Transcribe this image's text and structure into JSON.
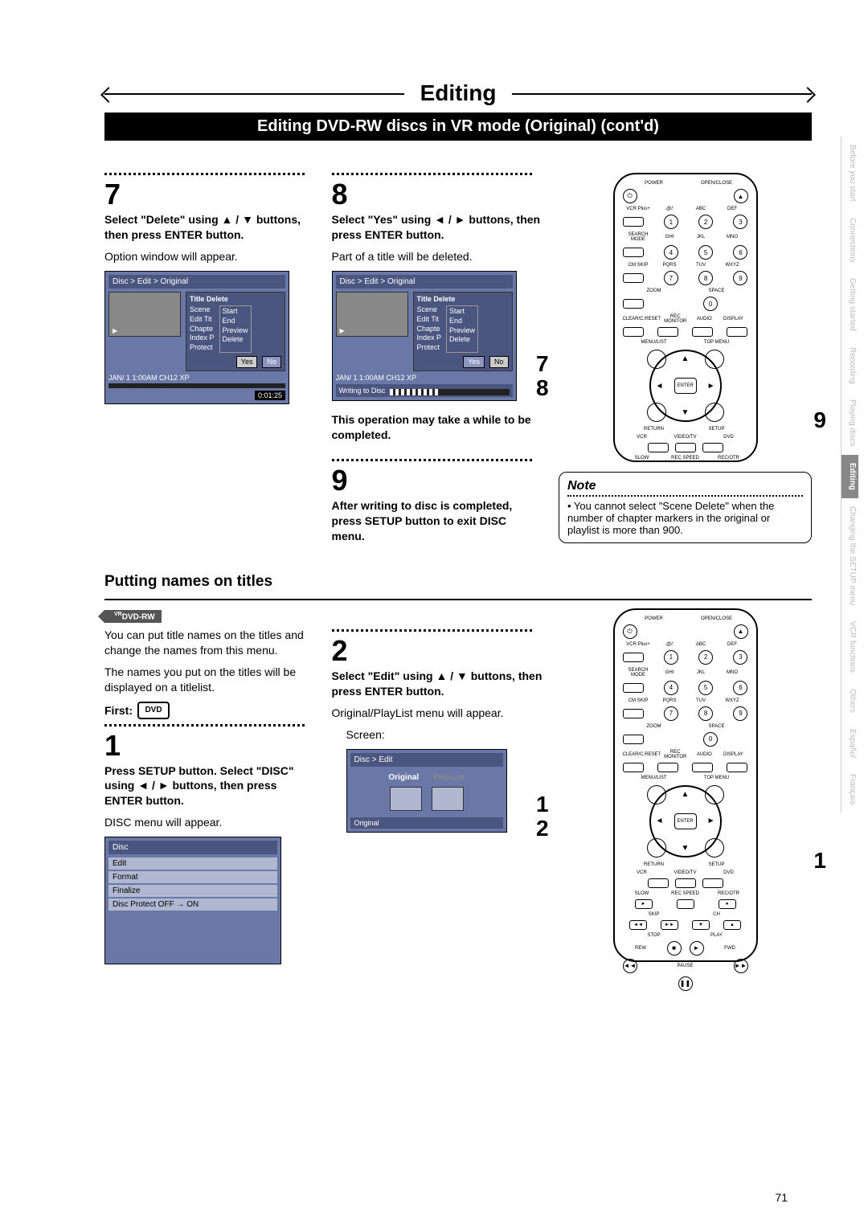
{
  "page_title": "Editing",
  "subtitle": "Editing DVD-RW discs in VR mode (Original) (cont'd)",
  "page_number": "71",
  "side_tabs": [
    "Before you start",
    "Connections",
    "Getting started",
    "Recording",
    "Playing discs",
    "Editing",
    "Changing the SETUP menu",
    "VCR functions",
    "Others",
    "Español",
    "Français"
  ],
  "active_side_tab": "Editing",
  "step7": {
    "num": "7",
    "instruction": "Select \"Delete\" using ▲ / ▼ buttons, then press ENTER button.",
    "body": "Option window will appear.",
    "screen": {
      "breadcrumb": "Disc > Edit > Original",
      "panel_title": "Title Delete",
      "rows": [
        "Scene",
        "Edit Tit",
        "Chapte",
        "Index P",
        "Protect"
      ],
      "rows_r": [
        "Start",
        "End",
        "Preview",
        "Delete"
      ],
      "yes": "Yes",
      "no": "No",
      "status": "JAN/ 1  1:00AM  CH12    XP",
      "timecode": "0:01:25"
    }
  },
  "step8": {
    "num": "8",
    "instruction": "Select \"Yes\" using ◄ / ► buttons, then press ENTER button.",
    "body": "Part of a title will be deleted.",
    "note": "This operation may take a while to be completed.",
    "screen": {
      "breadcrumb": "Disc > Edit > Original",
      "panel_title": "Title Delete",
      "rows": [
        "Scene",
        "Edit Tit",
        "Chapte",
        "Index P",
        "Protect"
      ],
      "rows_r": [
        "Start",
        "End",
        "Preview",
        "Delete"
      ],
      "yes": "Yes",
      "no": "No",
      "status": "JAN/ 1  1:00AM  CH12    XP",
      "writing": "Writing to Disc"
    }
  },
  "step9": {
    "num": "9",
    "instruction": "After writing to disc is completed, press SETUP button to exit DISC menu."
  },
  "note_box": {
    "title": "Note",
    "body": "• You cannot select \"Scene Delete\" when the number of chapter markers in the original or playlist is more than 900."
  },
  "section2": {
    "heading": "Putting names on titles",
    "badge": "DVD-RW",
    "badge_sup": "VR",
    "intro1": "You can put title names on the titles and change the names from this menu.",
    "intro2": "The names you put on the titles will be displayed on a titlelist.",
    "first_label": "First:",
    "step1": {
      "num": "1",
      "instruction": "Press SETUP button. Select \"DISC\" using ◄ / ► buttons, then press ENTER button.",
      "body": "DISC menu will appear.",
      "menu": {
        "header": "Disc",
        "items": [
          "Edit",
          "Format",
          "Finalize",
          "Disc Protect OFF → ON"
        ]
      }
    },
    "step2": {
      "num": "2",
      "instruction": "Select \"Edit\" using ▲ / ▼ buttons, then press ENTER button.",
      "body": "Original/PlayList menu will appear.",
      "body2": "Screen:",
      "menu": {
        "header": "Disc > Edit",
        "tab_original": "Original",
        "tab_playlist": "PlayList",
        "footer": "Original"
      }
    }
  },
  "remote_labels": {
    "power": "POWER",
    "open": "OPEN/CLOSE",
    "enter": "ENTER",
    "setup": "SETUP",
    "return": "RETURN",
    "menu": "MENU/LIST",
    "topmenu": "TOP MENU",
    "zoom": "ZOOM",
    "cmskip": "CM SKIP",
    "search": "SEARCH MODE",
    "vcrplus": "VCR Plus+",
    "clear": "CLEAR/C.RESET",
    "rec": "REC MONITOR",
    "audio": "AUDIO",
    "display": "DISPLAY",
    "vcr": "VCR",
    "videotv": "VIDEO/TV",
    "dvd": "DVD",
    "slow": "SLOW",
    "spd": "REC SPEED",
    "recotr": "REC/OTR",
    "skip": "SKIP",
    "ch": "CH",
    "stop": "STOP",
    "play": "PLAY",
    "rew": "REW",
    "fwd": "FWD",
    "pause": "PAUSE"
  },
  "callouts_upper": {
    "a": "7",
    "b": "8",
    "c": "9"
  },
  "callouts_lower": {
    "a": "1",
    "b": "2",
    "c": "1"
  }
}
